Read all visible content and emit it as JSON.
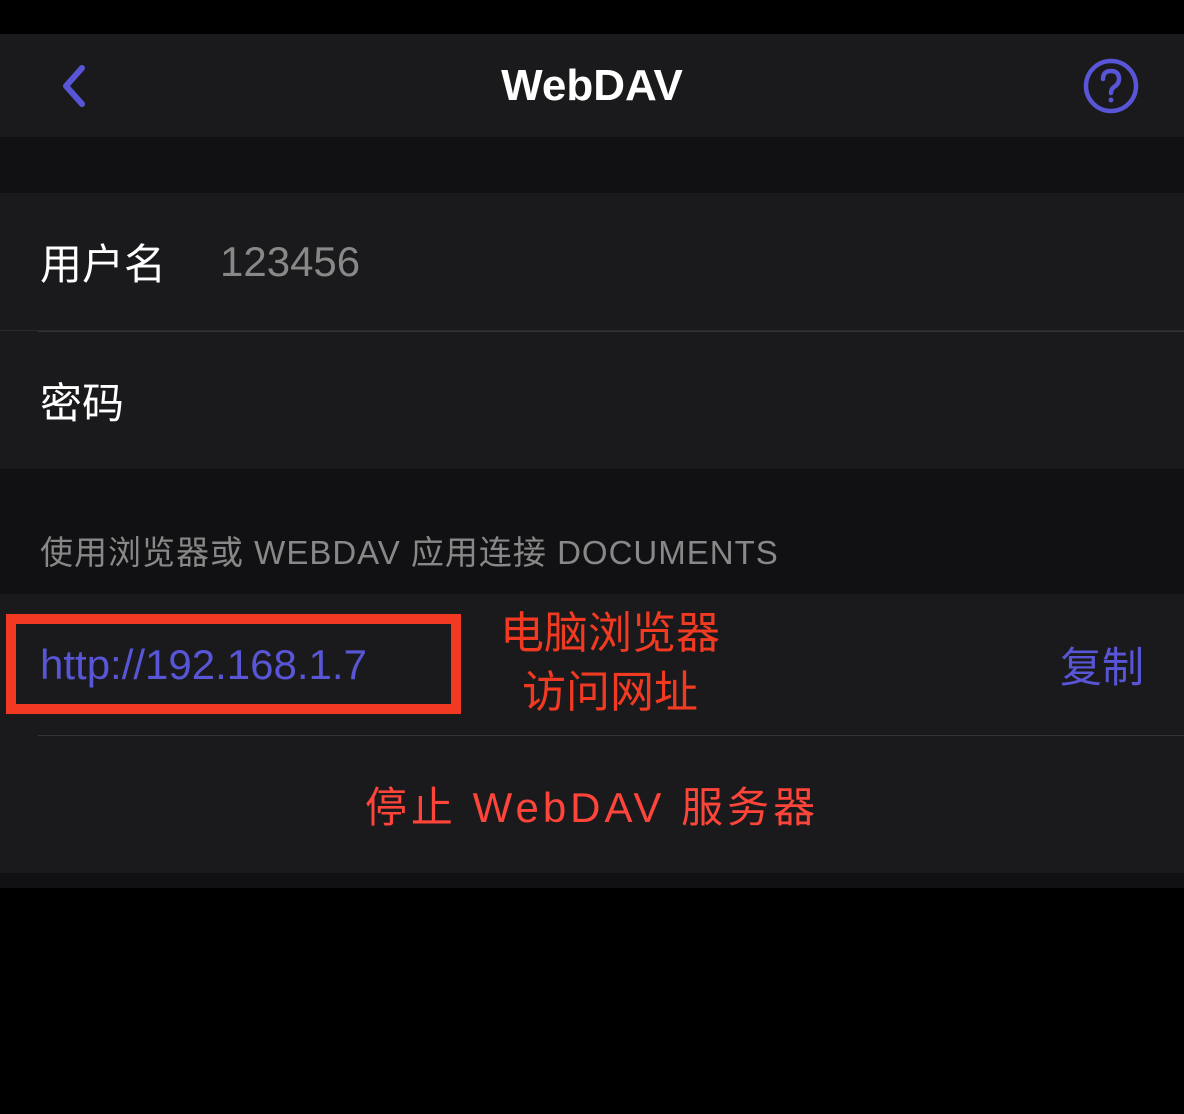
{
  "header": {
    "title": "WebDAV"
  },
  "credentials": {
    "username_label": "用户名",
    "username_value": "123456",
    "password_label": "密码",
    "password_value": ""
  },
  "connection": {
    "section_label": "使用浏览器或 WEBDAV 应用连接 DOCUMENTS",
    "url": "http://192.168.1.7",
    "copy_label": "复制",
    "annotation_line1": "电脑浏览器",
    "annotation_line2": "访问网址"
  },
  "actions": {
    "stop_label": "停止 WebDAV 服务器"
  },
  "colors": {
    "accent": "#5856d6",
    "danger": "#ff453a",
    "highlight": "#f23a22"
  }
}
